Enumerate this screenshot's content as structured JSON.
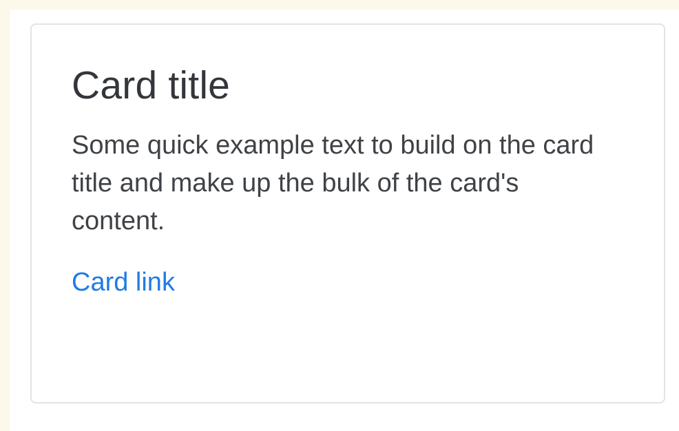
{
  "card": {
    "title": "Card title",
    "text": "Some quick example text to build on the card title and make up the bulk of the card's content.",
    "link_label": "Card link"
  },
  "colors": {
    "page_background": "#ffffff",
    "top_left_background": "#fcf8ea",
    "card_border": "#e3e3e3",
    "title_text": "#33363b",
    "body_text": "#3f4246",
    "link_text": "#1f7be4"
  }
}
